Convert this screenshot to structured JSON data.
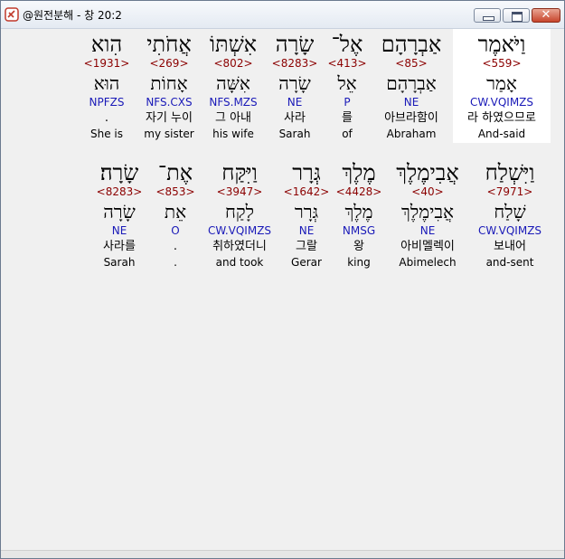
{
  "window": {
    "title": "@원전분해 - 창 20:2"
  },
  "line1": [
    {
      "heb": "וַיֹּאמֶר",
      "strong": "<559>",
      "lex": "אָמַר",
      "morph": "CW.VQIMZS",
      "kor": "라 하였으므로",
      "eng": "And-said",
      "highlight": true
    },
    {
      "heb": "אַבְרָהָם",
      "strong": "<85>",
      "lex": "אַבְרָהָם",
      "morph": "NE",
      "kor": "아브라함이",
      "eng": "Abraham",
      "highlight": false
    },
    {
      "heb": "אֶל־",
      "strong": "<413>",
      "lex": "אֵל",
      "morph": "P",
      "kor": "를",
      "eng": "of",
      "highlight": false
    },
    {
      "heb": "שָׂרָה",
      "strong": "<8283>",
      "lex": "שָׂרָה",
      "morph": "NE",
      "kor": "사라",
      "eng": "Sarah",
      "highlight": false
    },
    {
      "heb": "אִשְׁתּוֹ",
      "strong": "<802>",
      "lex": "אִשָּׁה",
      "morph": "NFS.MZS",
      "kor": "그 아내",
      "eng": "his wife",
      "highlight": false
    },
    {
      "heb": "אֲחֹתִי",
      "strong": "<269>",
      "lex": "אָחוֹת",
      "morph": "NFS.CXS",
      "kor": "자기 누이",
      "eng": "my sister",
      "highlight": false
    },
    {
      "heb": "הִוא",
      "strong": "<1931>",
      "lex": "הוּא",
      "morph": "NPFZS",
      "kor": ".",
      "eng": "She is",
      "highlight": false
    }
  ],
  "line2": [
    {
      "heb": "וַיִּשְׁלַח",
      "strong": "<7971>",
      "lex": "שָׁלַח",
      "morph": "CW.VQIMZS",
      "kor": "보내어",
      "eng": "and-sent",
      "highlight": false
    },
    {
      "heb": "אֲבִימֶלֶךְ",
      "strong": "<40>",
      "lex": "אֲבִימֶלֶךְ",
      "morph": "NE",
      "kor": "아비멜렉이",
      "eng": "Abimelech",
      "highlight": false
    },
    {
      "heb": "מֶלֶךְ",
      "strong": "<4428>",
      "lex": "מֶלֶךְ",
      "morph": "NMSG",
      "kor": "왕",
      "eng": "king",
      "highlight": false
    },
    {
      "heb": "גְּרָר",
      "strong": "<1642>",
      "lex": "גְּרָר",
      "morph": "NE",
      "kor": "그랄",
      "eng": "Gerar",
      "highlight": false
    },
    {
      "heb": "וַיִּקַּח",
      "strong": "<3947>",
      "lex": "לָקַח",
      "morph": "CW.VQIMZS",
      "kor": "취하였더니",
      "eng": "and took",
      "highlight": false
    },
    {
      "heb": "אֶת־",
      "strong": "<853>",
      "lex": "אֵת",
      "morph": "O",
      "kor": ".",
      "eng": ".",
      "highlight": false
    },
    {
      "heb": "שָׂרָה׃",
      "strong": "<8283>",
      "lex": "שָׂרָה",
      "morph": "NE",
      "kor": "사라를",
      "eng": "Sarah",
      "highlight": false
    }
  ]
}
